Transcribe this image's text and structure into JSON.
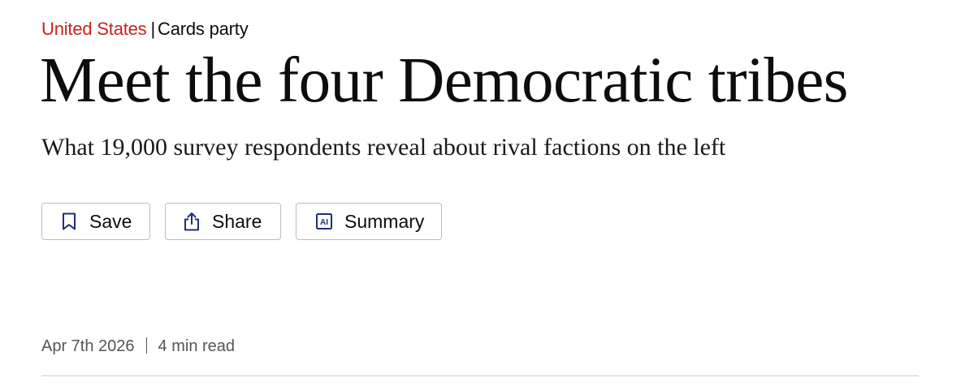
{
  "kicker": {
    "section": "United States",
    "separator": "|",
    "topic": "Cards party"
  },
  "headline": "Meet the four Democratic tribes",
  "subheadline": "What 19,000 survey respondents reveal about rival factions on the left",
  "actions": {
    "save": {
      "label": "Save",
      "icon": "bookmark-icon"
    },
    "share": {
      "label": "Share",
      "icon": "share-icon"
    },
    "summary": {
      "label": "Summary",
      "icon": "ai-icon",
      "icon_text": "AI"
    }
  },
  "meta": {
    "date": "Apr 7th 2026",
    "read_time": "4 min read"
  },
  "colors": {
    "section": "#c6231c",
    "icon": "#1f2e7a",
    "text": "#0d0d0d",
    "meta": "#555555"
  }
}
